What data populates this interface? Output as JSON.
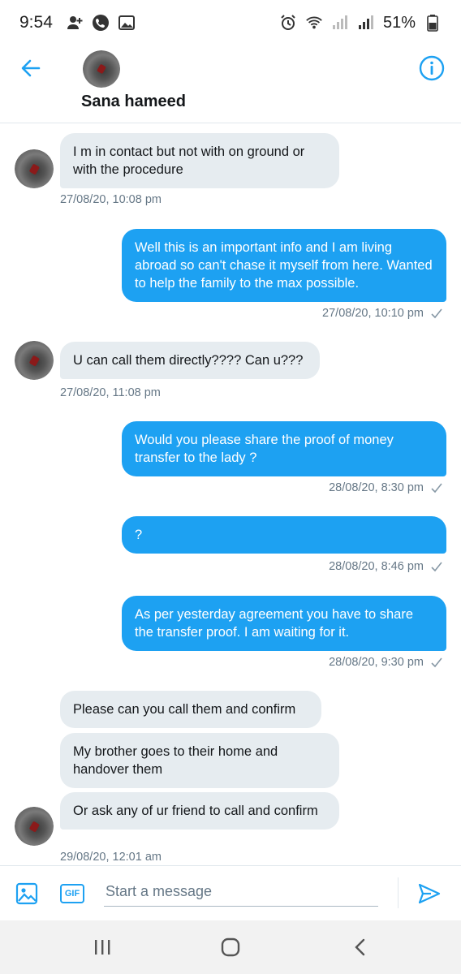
{
  "status_bar": {
    "time": "9:54",
    "battery": "51%",
    "icons": [
      "person-add-icon",
      "phone-icon",
      "image-icon",
      "alarm-icon",
      "wifi-icon",
      "signal-icon",
      "signal-icon",
      "battery-icon"
    ]
  },
  "header": {
    "contact_name": "Sana hameed",
    "back_icon": "back-arrow-icon",
    "info_icon": "info-icon",
    "accent_color": "#1da1f2"
  },
  "messages": [
    {
      "direction": "in",
      "text": "I m in contact but not with on ground or with the procedure",
      "timestamp": "27/08/20, 10:08 pm"
    },
    {
      "direction": "out",
      "text": "Well this is an important info and I am living abroad so can't chase it myself from here. Wanted to help the family to the max possible.",
      "timestamp": "27/08/20, 10:10 pm"
    },
    {
      "direction": "in",
      "text": "U can call them directly???? Can u???",
      "timestamp": "27/08/20, 11:08 pm"
    },
    {
      "direction": "out",
      "text": "Would you please share the proof of money transfer to the lady ?",
      "timestamp": "28/08/20, 8:30 pm"
    },
    {
      "direction": "out",
      "text": "?",
      "timestamp": "28/08/20, 8:46 pm"
    },
    {
      "direction": "out",
      "text": "As per yesterday agreement you have to share the transfer proof. I am waiting for it.",
      "timestamp": "28/08/20, 9:30 pm"
    },
    {
      "direction": "in",
      "text": "Please can you call them and confirm"
    },
    {
      "direction": "in",
      "text": "My brother goes to their home and handover them"
    },
    {
      "direction": "in",
      "text": "Or ask any of ur friend to call and confirm",
      "timestamp": "29/08/20, 12:01 am"
    }
  ],
  "composer": {
    "placeholder": "Start a message",
    "gif_label": "GIF",
    "icons": [
      "image-icon",
      "gif-icon",
      "send-icon"
    ]
  },
  "nav_bar": {
    "icons": [
      "recent-apps-icon",
      "home-icon",
      "back-icon"
    ]
  },
  "colors": {
    "outgoing_bubble": "#1da1f2",
    "incoming_bubble": "#e6ecf0",
    "timestamp": "#657786"
  }
}
